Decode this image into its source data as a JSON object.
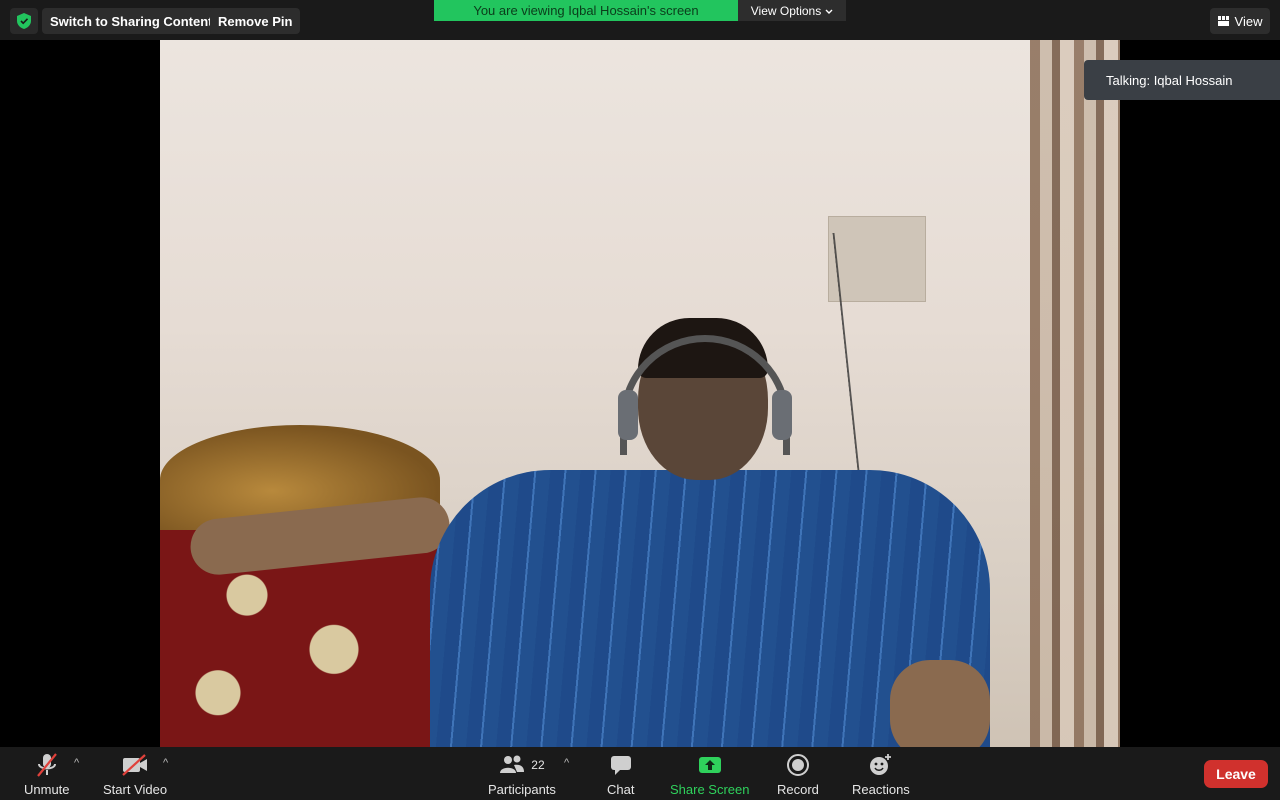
{
  "topbar": {
    "switch_label": "Switch to Sharing Content",
    "remove_pin_label": "Remove Pin",
    "viewing_banner": "You are viewing Iqbal Hossain's screen",
    "view_options_label": "View Options",
    "view_label": "View"
  },
  "video": {
    "talking_label": "Talking: Iqbal Hossain"
  },
  "toolbar": {
    "unmute_label": "Unmute",
    "start_video_label": "Start Video",
    "participants_label": "Participants",
    "participants_count": "22",
    "chat_label": "Chat",
    "share_screen_label": "Share Screen",
    "record_label": "Record",
    "reactions_label": "Reactions",
    "leave_label": "Leave"
  },
  "colors": {
    "share_green": "#2fd15c",
    "banner_green": "#22c55e",
    "leave_red": "#d0312d",
    "muted_red": "#e0413b"
  },
  "icons": [
    "shield-icon",
    "chevron-down-icon",
    "grid-icon",
    "mic-muted-icon",
    "video-off-icon",
    "participants-icon",
    "chat-icon",
    "share-screen-icon",
    "record-icon",
    "reactions-icon"
  ]
}
